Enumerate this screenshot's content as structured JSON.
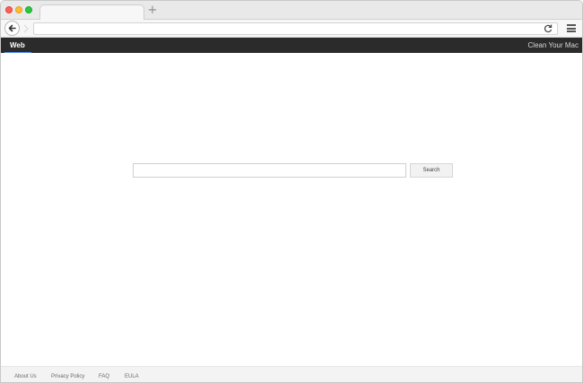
{
  "browser": {
    "new_tab_glyph": "+",
    "icons": [
      "back-arrow-icon",
      "forward-arrow-icon",
      "reload-icon",
      "hamburger-menu-icon",
      "plus-icon"
    ],
    "colors": {
      "close": "#ff5f57",
      "minimize": "#febc2e",
      "maximize": "#28c840"
    }
  },
  "navbar": {
    "web_label": "Web",
    "right_link": "Clean Your Mac",
    "background": "#2b2b2b",
    "accent": "#4c8ae8"
  },
  "search": {
    "input_value": "",
    "button_label": "Search"
  },
  "footer": {
    "links": [
      "About Us",
      "Privacy Policy",
      "FAQ",
      "EULA"
    ]
  }
}
